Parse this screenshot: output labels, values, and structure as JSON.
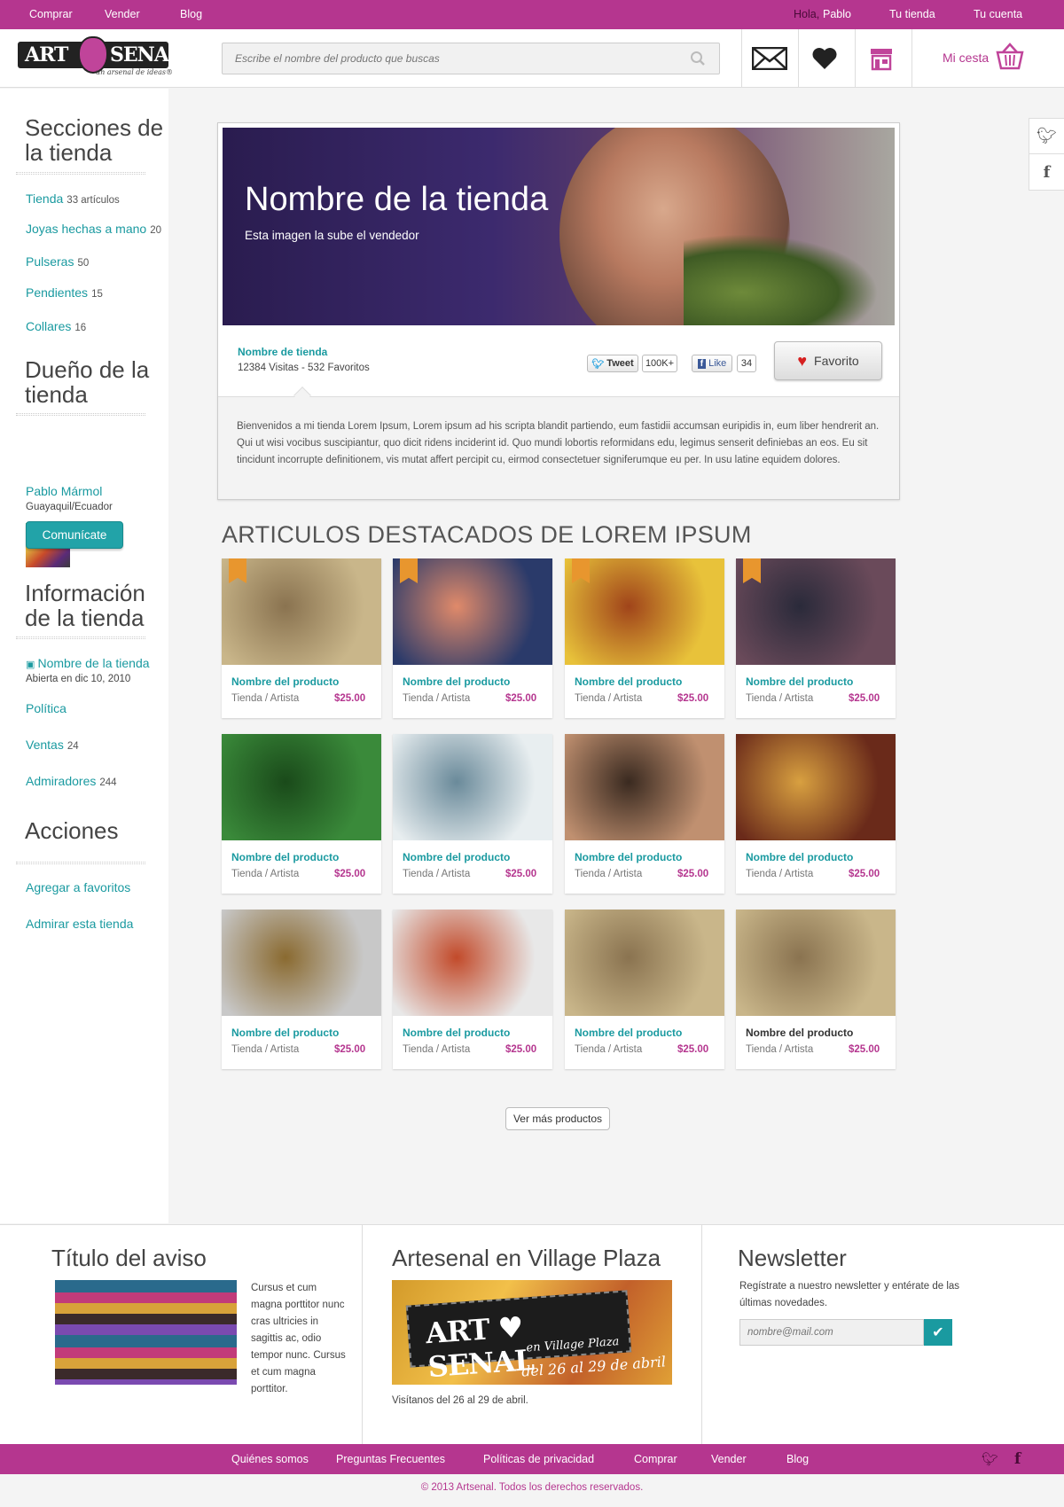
{
  "topbar": {
    "links": [
      "Comprar",
      "Vender",
      "Blog"
    ],
    "greeting_prefix": "Hola,",
    "greeting_name": "Pablo",
    "your_store": "Tu tienda",
    "your_account": "Tu cuenta"
  },
  "header": {
    "logo_left": "ART",
    "logo_right": "SENAL",
    "logo_tagline": "un arsenal de ideas®",
    "search_placeholder": "Escribe el nombre del producto que buscas",
    "cart_label": "Mi cesta"
  },
  "sidebar": {
    "sections_title": "Secciones de la tienda",
    "sections": [
      {
        "label": "Tienda",
        "count": "33 artículos"
      },
      {
        "label": "Joyas hechas a mano",
        "count": "20"
      },
      {
        "label": "Pulseras",
        "count": "50"
      },
      {
        "label": "Pendientes",
        "count": "15"
      },
      {
        "label": "Collares",
        "count": "16"
      }
    ],
    "owner_title": "Dueño de la tienda",
    "owner_name": "Pablo Mármol",
    "owner_location": "Guayaquil/Ecuador",
    "contact_button": "Comunícate",
    "info_title": "Información de la tienda",
    "info_store_name": "Nombre de la tienda",
    "info_opened": "Abierta en dic 10, 2010",
    "info_policy": "Política",
    "info_sales": "Ventas",
    "info_sales_count": "24",
    "info_admirers": "Admiradores",
    "info_admirers_count": "244",
    "actions_title": "Acciones",
    "action_fav": "Agregar a favoritos",
    "action_admire": "Admirar esta tienda"
  },
  "store": {
    "banner_title": "Nombre de la tienda",
    "banner_subtitle": "Esta imagen la sube el vendedor",
    "name": "Nombre de tienda",
    "stats": "12384 Visitas - 532 Favoritos",
    "tweet_label": "Tweet",
    "tweet_count": "100K+",
    "like_label": "Like",
    "like_count": "34",
    "favorite_button": "Favorito",
    "description": "Bienvenidos a mi tienda  Lorem Ipsum, Lorem ipsum ad his scripta blandit partiendo, eum fastidii accumsan euripidis in, eum liber hendrerit an. Qui ut wisi vocibus suscipiantur, quo dicit ridens inciderint id. Quo mundi lobortis reformidans edu, legimus senserit definiebas an eos. Eu sit tincidunt incorrupte definitionem, vis mutat affert percipit cu, eirmod consectetuer signiferumque eu per. In usu latine equidem dolores."
  },
  "featured": {
    "title": "ARTICULOS DESTACADOS DE LOREM IPSUM",
    "products": [
      {
        "name": "Nombre del producto",
        "store": "Tienda / Artista",
        "price": "$25.00",
        "color1": "#c9b68a",
        "color2": "#8a7350",
        "ribbon": true
      },
      {
        "name": "Nombre del producto",
        "store": "Tienda / Artista",
        "price": "$25.00",
        "color1": "#2a3a6a",
        "color2": "#e08a6a",
        "ribbon": true
      },
      {
        "name": "Nombre del producto",
        "store": "Tienda / Artista",
        "price": "$25.00",
        "color1": "#e8c23a",
        "color2": "#a0441a",
        "ribbon": true
      },
      {
        "name": "Nombre del producto",
        "store": "Tienda / Artista",
        "price": "$25.00",
        "color1": "#6a4a5a",
        "color2": "#2a2a3a",
        "ribbon": true
      },
      {
        "name": "Nombre del producto",
        "store": "Tienda / Artista",
        "price": "$25.00",
        "color1": "#3a8a3a",
        "color2": "#1a4a1a",
        "ribbon": false
      },
      {
        "name": "Nombre del producto",
        "store": "Tienda / Artista",
        "price": "$25.00",
        "color1": "#e8eef0",
        "color2": "#6a8a9a",
        "ribbon": false
      },
      {
        "name": "Nombre del producto",
        "store": "Tienda / Artista",
        "price": "$25.00",
        "color1": "#c09070",
        "color2": "#3a2a20",
        "ribbon": false
      },
      {
        "name": "Nombre del producto",
        "store": "Tienda / Artista",
        "price": "$25.00",
        "color1": "#6a2a1a",
        "color2": "#d8a040",
        "ribbon": false
      },
      {
        "name": "Nombre del producto",
        "store": "Tienda / Artista",
        "price": "$25.00",
        "color1": "#c8c8c8",
        "color2": "#8a6a30",
        "ribbon": false
      },
      {
        "name": "Nombre del producto",
        "store": "Tienda / Artista",
        "price": "$25.00",
        "color1": "#e8e8e8",
        "color2": "#c24a2a",
        "ribbon": false
      },
      {
        "name": "Nombre del producto",
        "store": "Tienda / Artista",
        "price": "$25.00",
        "color1": "#c9b68a",
        "color2": "#8a7350",
        "ribbon": false
      },
      {
        "name": "Nombre del producto",
        "store": "Tienda / Artista",
        "price": "$25.00",
        "color1": "#c9b68a",
        "color2": "#8a7350",
        "ribbon": false,
        "dark_name": true
      }
    ],
    "more_button": "Ver más productos"
  },
  "footer": {
    "notice_title": "Título del aviso",
    "notice_text": "Cursus et cum magna porttitor nunc cras ultricies in sagittis ac, odio tempor nunc. Cursus et cum magna porttitor.",
    "event_title": "Artesenal en Village Plaza",
    "event_badge": "ART ♥ SENAL",
    "event_badge_sub": "en Village Plaza",
    "event_dates": "del 26 al 29 de abril",
    "event_caption": "Visítanos del 26 al 29 de abril.",
    "newsletter_title": "Newsletter",
    "newsletter_text": "Regístrate a nuestro newsletter y entérate de las últimas novedades.",
    "newsletter_placeholder": "nombre@mail.com"
  },
  "bottombar": {
    "links": [
      "Quiénes somos",
      "Preguntas Frecuentes",
      "Políticas de privacidad",
      "Comprar",
      "Vender",
      "Blog"
    ]
  },
  "copyright": "© 2013 Artsenal. Todos los derechos reservados.",
  "colors": {
    "brand": "#b5368f",
    "accent": "#1a9aa0",
    "price": "#b5368f"
  }
}
